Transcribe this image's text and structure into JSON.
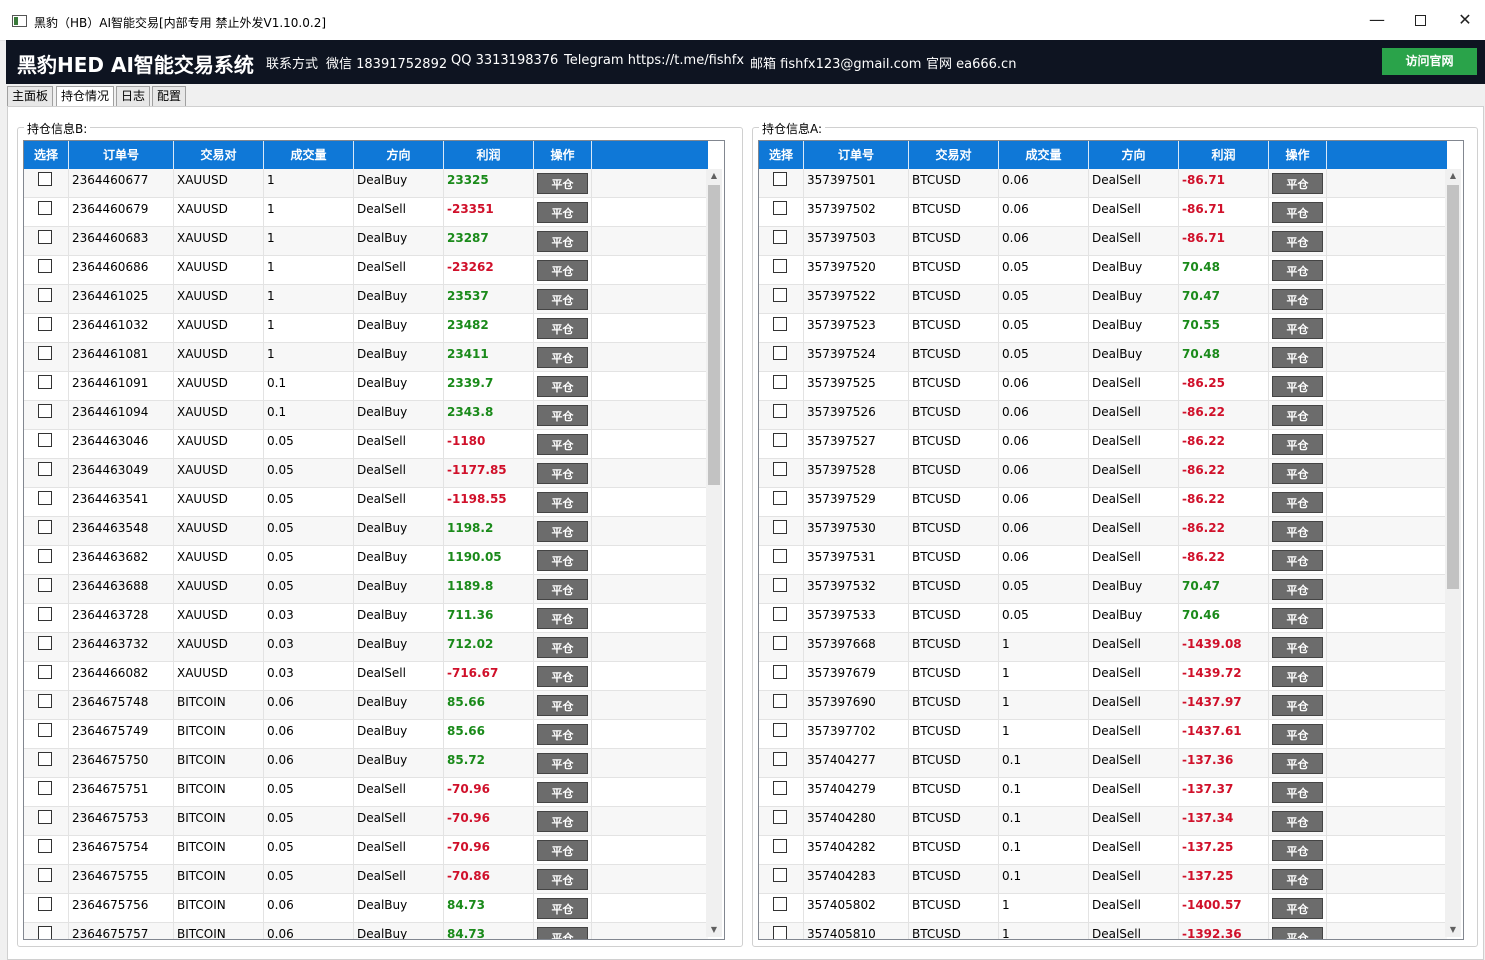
{
  "window": {
    "title": "黑豹（HB）AI智能交易[内部专用 禁止外发V1.10.0.2]",
    "min": "—",
    "max": "",
    "close": "✕"
  },
  "header": {
    "brand": "黑豹HED AI智能交易系统",
    "contact_label": "联系方式",
    "wechat": "微信 18391752892",
    "qq": "QQ 3313198376",
    "telegram": "Telegram https://t.me/fishfx",
    "email": "邮箱 fishfx123@gmail.com",
    "site": "官网 ea666.cn",
    "visit_button": "访问官网"
  },
  "tabs": [
    {
      "label": "主面板",
      "active": false
    },
    {
      "label": "持仓情况",
      "active": true
    },
    {
      "label": "日志",
      "active": false
    },
    {
      "label": "配置",
      "active": false
    }
  ],
  "columns": [
    "选择",
    "订单号",
    "交易对",
    "成交量",
    "方向",
    "利润",
    "操作"
  ],
  "close_label": "平仓",
  "colors": {
    "header_blue": "#0f78d7",
    "profit_positive": "#1a8a1a",
    "profit_negative": "#d0102a",
    "visit_green": "#2aa34a"
  },
  "panel_b": {
    "label": "持仓信息B:",
    "rows": [
      [
        "2364460677",
        "XAUUSD",
        "1",
        "DealBuy",
        "23325"
      ],
      [
        "2364460679",
        "XAUUSD",
        "1",
        "DealSell",
        "-23351"
      ],
      [
        "2364460683",
        "XAUUSD",
        "1",
        "DealBuy",
        "23287"
      ],
      [
        "2364460686",
        "XAUUSD",
        "1",
        "DealSell",
        "-23262"
      ],
      [
        "2364461025",
        "XAUUSD",
        "1",
        "DealBuy",
        "23537"
      ],
      [
        "2364461032",
        "XAUUSD",
        "1",
        "DealBuy",
        "23482"
      ],
      [
        "2364461081",
        "XAUUSD",
        "1",
        "DealBuy",
        "23411"
      ],
      [
        "2364461091",
        "XAUUSD",
        "0.1",
        "DealBuy",
        "2339.7"
      ],
      [
        "2364461094",
        "XAUUSD",
        "0.1",
        "DealBuy",
        "2343.8"
      ],
      [
        "2364463046",
        "XAUUSD",
        "0.05",
        "DealSell",
        "-1180"
      ],
      [
        "2364463049",
        "XAUUSD",
        "0.05",
        "DealSell",
        "-1177.85"
      ],
      [
        "2364463541",
        "XAUUSD",
        "0.05",
        "DealSell",
        "-1198.55"
      ],
      [
        "2364463548",
        "XAUUSD",
        "0.05",
        "DealBuy",
        "1198.2"
      ],
      [
        "2364463682",
        "XAUUSD",
        "0.05",
        "DealBuy",
        "1190.05"
      ],
      [
        "2364463688",
        "XAUUSD",
        "0.05",
        "DealBuy",
        "1189.8"
      ],
      [
        "2364463728",
        "XAUUSD",
        "0.03",
        "DealBuy",
        "711.36"
      ],
      [
        "2364463732",
        "XAUUSD",
        "0.03",
        "DealBuy",
        "712.02"
      ],
      [
        "2364466082",
        "XAUUSD",
        "0.03",
        "DealSell",
        "-716.67"
      ],
      [
        "2364675748",
        "BITCOIN",
        "0.06",
        "DealBuy",
        "85.66"
      ],
      [
        "2364675749",
        "BITCOIN",
        "0.06",
        "DealBuy",
        "85.66"
      ],
      [
        "2364675750",
        "BITCOIN",
        "0.06",
        "DealBuy",
        "85.72"
      ],
      [
        "2364675751",
        "BITCOIN",
        "0.05",
        "DealSell",
        "-70.96"
      ],
      [
        "2364675753",
        "BITCOIN",
        "0.05",
        "DealSell",
        "-70.96"
      ],
      [
        "2364675754",
        "BITCOIN",
        "0.05",
        "DealSell",
        "-70.96"
      ],
      [
        "2364675755",
        "BITCOIN",
        "0.05",
        "DealSell",
        "-70.86"
      ],
      [
        "2364675756",
        "BITCOIN",
        "0.06",
        "DealBuy",
        "84.73"
      ],
      [
        "2364675757",
        "BITCOIN",
        "0.06",
        "DealBuy",
        "84.73"
      ]
    ]
  },
  "panel_a": {
    "label": "持仓信息A:",
    "rows": [
      [
        "357397501",
        "BTCUSD",
        "0.06",
        "DealSell",
        "-86.71"
      ],
      [
        "357397502",
        "BTCUSD",
        "0.06",
        "DealSell",
        "-86.71"
      ],
      [
        "357397503",
        "BTCUSD",
        "0.06",
        "DealSell",
        "-86.71"
      ],
      [
        "357397520",
        "BTCUSD",
        "0.05",
        "DealBuy",
        "70.48"
      ],
      [
        "357397522",
        "BTCUSD",
        "0.05",
        "DealBuy",
        "70.47"
      ],
      [
        "357397523",
        "BTCUSD",
        "0.05",
        "DealBuy",
        "70.55"
      ],
      [
        "357397524",
        "BTCUSD",
        "0.05",
        "DealBuy",
        "70.48"
      ],
      [
        "357397525",
        "BTCUSD",
        "0.06",
        "DealSell",
        "-86.25"
      ],
      [
        "357397526",
        "BTCUSD",
        "0.06",
        "DealSell",
        "-86.22"
      ],
      [
        "357397527",
        "BTCUSD",
        "0.06",
        "DealSell",
        "-86.22"
      ],
      [
        "357397528",
        "BTCUSD",
        "0.06",
        "DealSell",
        "-86.22"
      ],
      [
        "357397529",
        "BTCUSD",
        "0.06",
        "DealSell",
        "-86.22"
      ],
      [
        "357397530",
        "BTCUSD",
        "0.06",
        "DealSell",
        "-86.22"
      ],
      [
        "357397531",
        "BTCUSD",
        "0.06",
        "DealSell",
        "-86.22"
      ],
      [
        "357397532",
        "BTCUSD",
        "0.05",
        "DealBuy",
        "70.47"
      ],
      [
        "357397533",
        "BTCUSD",
        "0.05",
        "DealBuy",
        "70.46"
      ],
      [
        "357397668",
        "BTCUSD",
        "1",
        "DealSell",
        "-1439.08"
      ],
      [
        "357397679",
        "BTCUSD",
        "1",
        "DealSell",
        "-1439.72"
      ],
      [
        "357397690",
        "BTCUSD",
        "1",
        "DealSell",
        "-1437.97"
      ],
      [
        "357397702",
        "BTCUSD",
        "1",
        "DealSell",
        "-1437.61"
      ],
      [
        "357404277",
        "BTCUSD",
        "0.1",
        "DealSell",
        "-137.36"
      ],
      [
        "357404279",
        "BTCUSD",
        "0.1",
        "DealSell",
        "-137.37"
      ],
      [
        "357404280",
        "BTCUSD",
        "0.1",
        "DealSell",
        "-137.34"
      ],
      [
        "357404282",
        "BTCUSD",
        "0.1",
        "DealSell",
        "-137.25"
      ],
      [
        "357404283",
        "BTCUSD",
        "0.1",
        "DealSell",
        "-137.25"
      ],
      [
        "357405802",
        "BTCUSD",
        "1",
        "DealSell",
        "-1400.57"
      ],
      [
        "357405810",
        "BTCUSD",
        "1",
        "DealSell",
        "-1392.36"
      ]
    ]
  }
}
